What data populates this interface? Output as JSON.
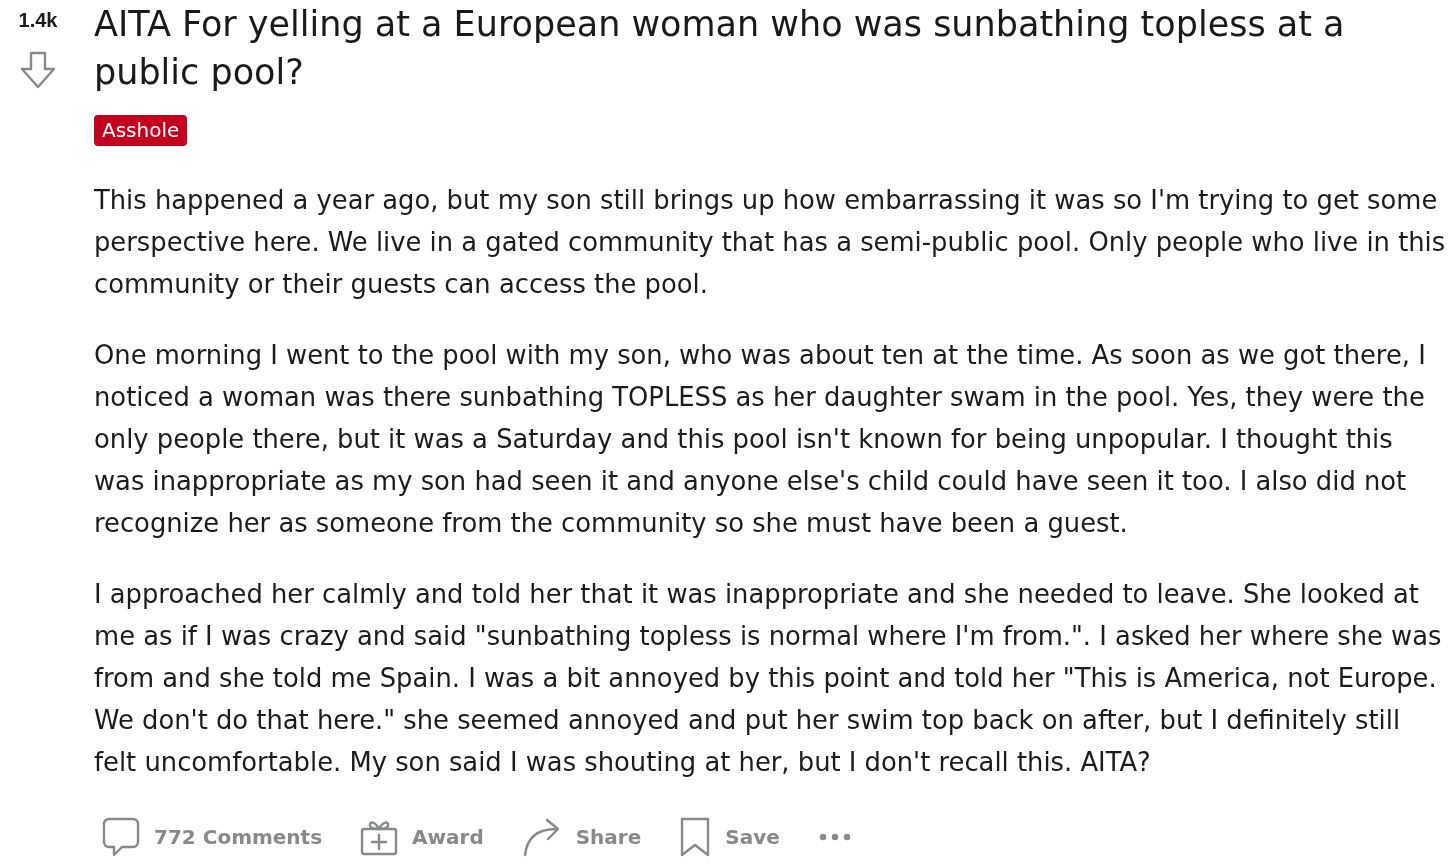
{
  "post": {
    "votes": "1.4k",
    "title": "AITA For yelling at a European woman who was sunbathing topless at a public pool?",
    "flair": "Asshole",
    "body": [
      "This happened a year ago, but my son still brings up how embarrassing it was so I'm trying to get some perspective here. We live in a gated community that has a semi-public pool. Only people who live in this community or their guests can access the pool.",
      "One morning I went to the pool with my son, who was about ten at the time. As soon as we got there, I noticed a woman was there sunbathing TOPLESS as her daughter swam in the pool. Yes, they were the only people there, but it was a Saturday and this pool isn't known for being unpopular. I thought this was inappropriate as my son had seen it and anyone else's child could have seen it too. I also did not recognize her as someone from the community so she must have been a guest.",
      "I approached her calmly and told her that it was inappropriate and she needed to leave. She looked at me as if I was crazy and said \"sunbathing topless is normal where I'm from.\". I asked her where she was from and she told me Spain. I was a bit annoyed by this point and told her \"This is America, not Europe. We don't do that here.\" she seemed annoyed and put her swim top back on after, but I definitely still felt uncomfortable. My son said I was shouting at her, but I don't recall this. AITA?"
    ]
  },
  "actions": [
    {
      "kind": "comments",
      "label": "772 Comments"
    },
    {
      "kind": "award",
      "label": "Award"
    },
    {
      "kind": "share",
      "label": "Share"
    },
    {
      "kind": "save",
      "label": "Save"
    },
    {
      "kind": "more"
    }
  ]
}
